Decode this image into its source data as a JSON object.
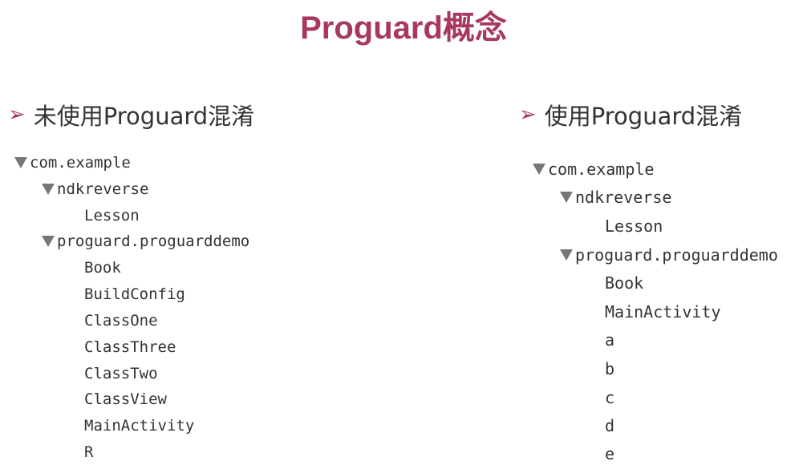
{
  "title": "Proguard概念",
  "left": {
    "heading": "未使用Proguard混淆",
    "tree": {
      "root": "com.example",
      "pkg1": "ndkreverse",
      "pkg1_items": [
        "Lesson"
      ],
      "pkg2": "proguard.proguarddemo",
      "pkg2_items": [
        "Book",
        "BuildConfig",
        "ClassOne",
        "ClassThree",
        "ClassTwo",
        "ClassView",
        "MainActivity",
        "R"
      ]
    }
  },
  "right": {
    "heading": "使用Proguard混淆",
    "tree": {
      "root": "com.example",
      "pkg1": "ndkreverse",
      "pkg1_items": [
        "Lesson"
      ],
      "pkg2": "proguard.proguarddemo",
      "pkg2_items": [
        "Book",
        "MainActivity",
        "a",
        "b",
        "c",
        "d",
        "e"
      ]
    }
  },
  "icons": {
    "bullet": "arrowhead-bullet-icon",
    "expand": "disclosure-triangle-expanded-icon"
  },
  "colors": {
    "accent": "#a73a5c",
    "text": "#333333",
    "triangle": "#777777"
  }
}
